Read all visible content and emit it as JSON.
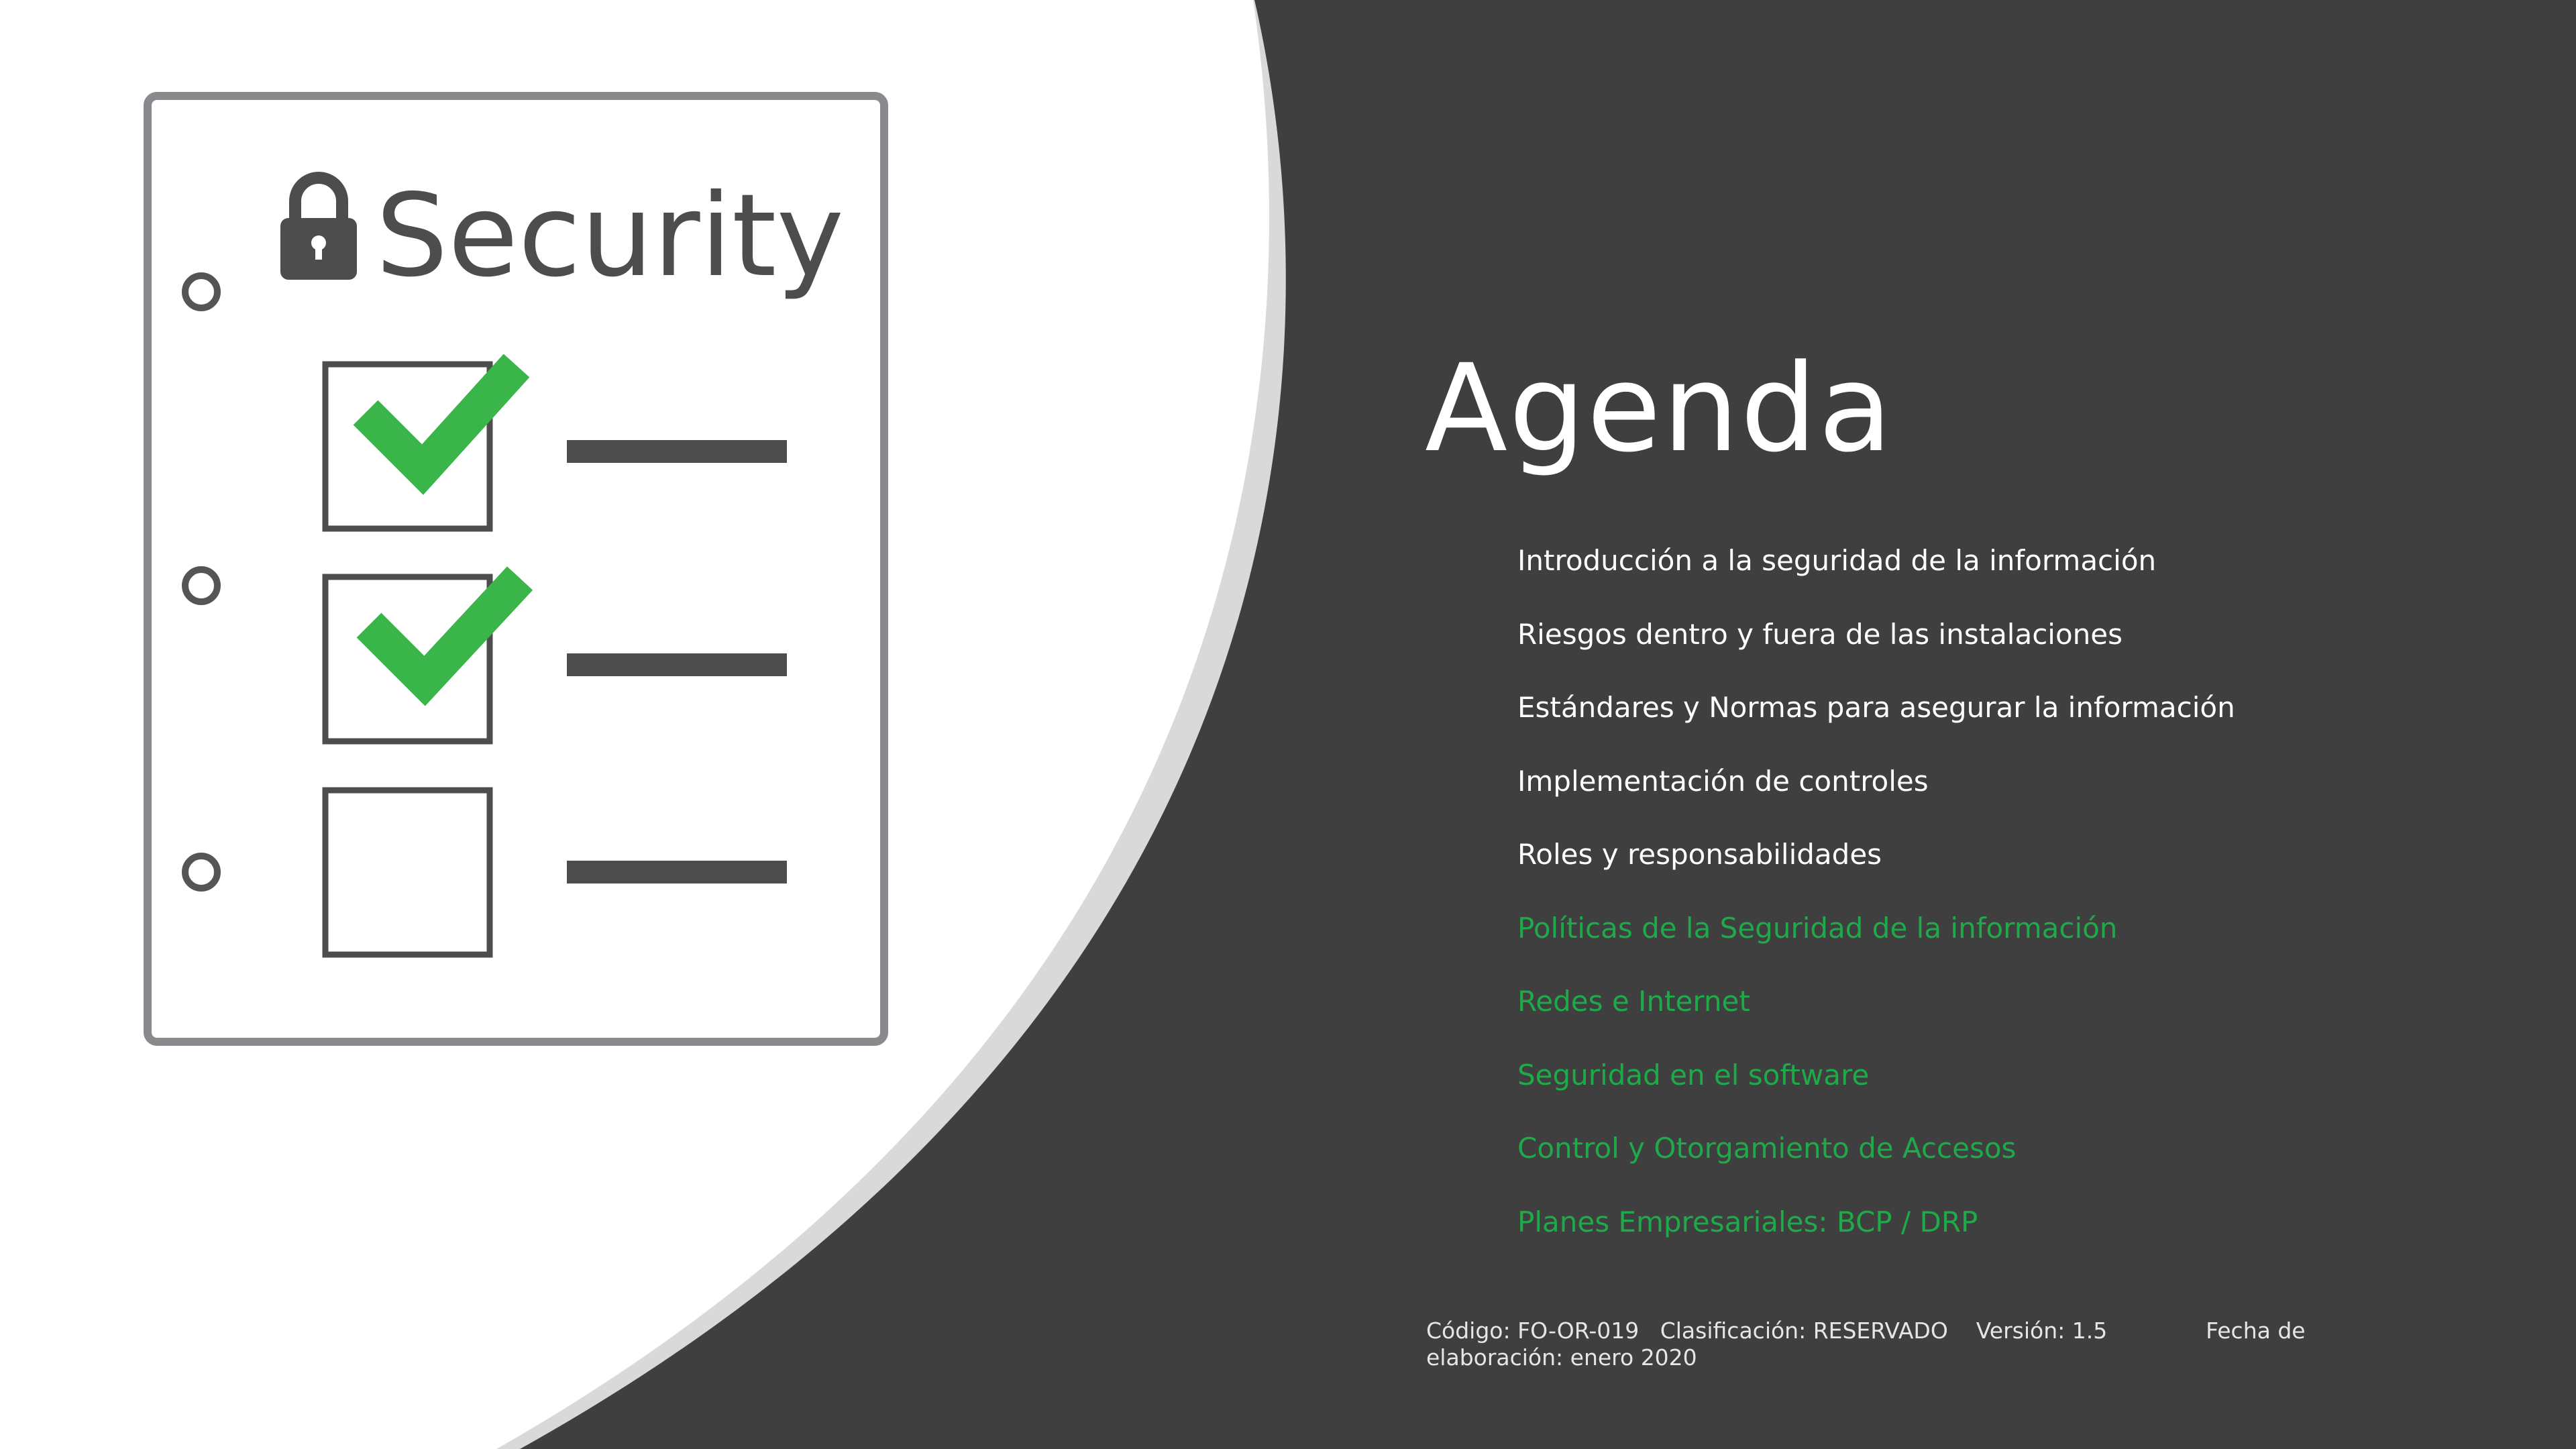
{
  "slide": {
    "title": "Agenda",
    "items": [
      {
        "label": "Introducción a la seguridad de la información",
        "color": "#ffffff"
      },
      {
        "label": "Riesgos dentro y fuera de las instalaciones",
        "color": "#ffffff"
      },
      {
        "label": "Estándares y Normas para asegurar la información",
        "color": "#ffffff"
      },
      {
        "label": "Implementación de controles",
        "color": "#ffffff"
      },
      {
        "label": "Roles y responsabilidades",
        "color": "#ffffff"
      },
      {
        "label": "Políticas de la Seguridad de la información",
        "color": "#1faa4a"
      },
      {
        "label": "Redes e Internet",
        "color": "#1faa4a"
      },
      {
        "label": "Seguridad en el software",
        "color": "#1faa4a"
      },
      {
        "label": "Control y Otorgamiento de Accesos",
        "color": "#1faa4a"
      },
      {
        "label": "Planes Empresariales: BCP / DRP",
        "color": "#1faa4a"
      }
    ],
    "footer": "Código: FO-OR-019   Clasificación: RESERVADO    Versión: 1.5              Fecha de elaboración: enero 2020"
  },
  "illustration": {
    "heading": "Security",
    "icons": [
      "lock-icon",
      "checkmark-icon"
    ],
    "checklist": [
      true,
      true,
      false
    ]
  },
  "colors": {
    "background": "#3f3f3f",
    "panel": "#ffffff",
    "panel_border": "#d9d9d9",
    "accent_green": "#1faa4a",
    "check_green": "#39b54a"
  }
}
